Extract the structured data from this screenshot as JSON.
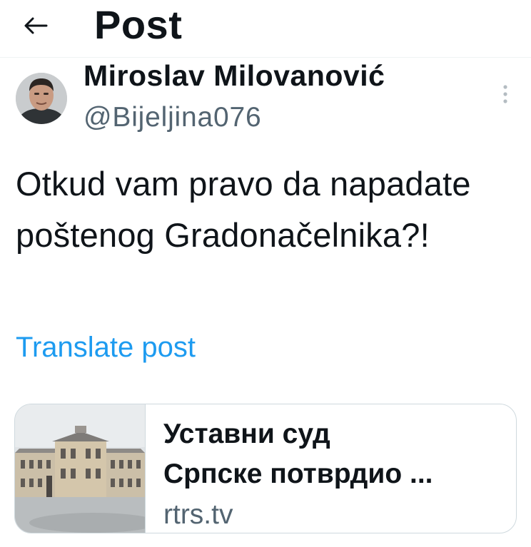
{
  "header": {
    "title": "Post",
    "back_icon": "arrow-left-icon"
  },
  "author": {
    "name": "Miroslav Milovanović",
    "handle": "@Bijeljina076",
    "avatar_icon": "avatar-photo",
    "more_icon": "more-vertical-icon"
  },
  "post": {
    "text": "Otkud vam pravo da napadate poštenog Gradonačelnika?!",
    "translate_label": "Translate post"
  },
  "card": {
    "image_icon": "building-photo",
    "title_line1": "Уставни суд",
    "title_line2": "Српске потврдио ...",
    "domain": "rtrs.tv"
  },
  "colors": {
    "link": "#1d9bf0",
    "secondary_text": "#536471",
    "border": "#cfd9de",
    "text": "#0f1419"
  }
}
